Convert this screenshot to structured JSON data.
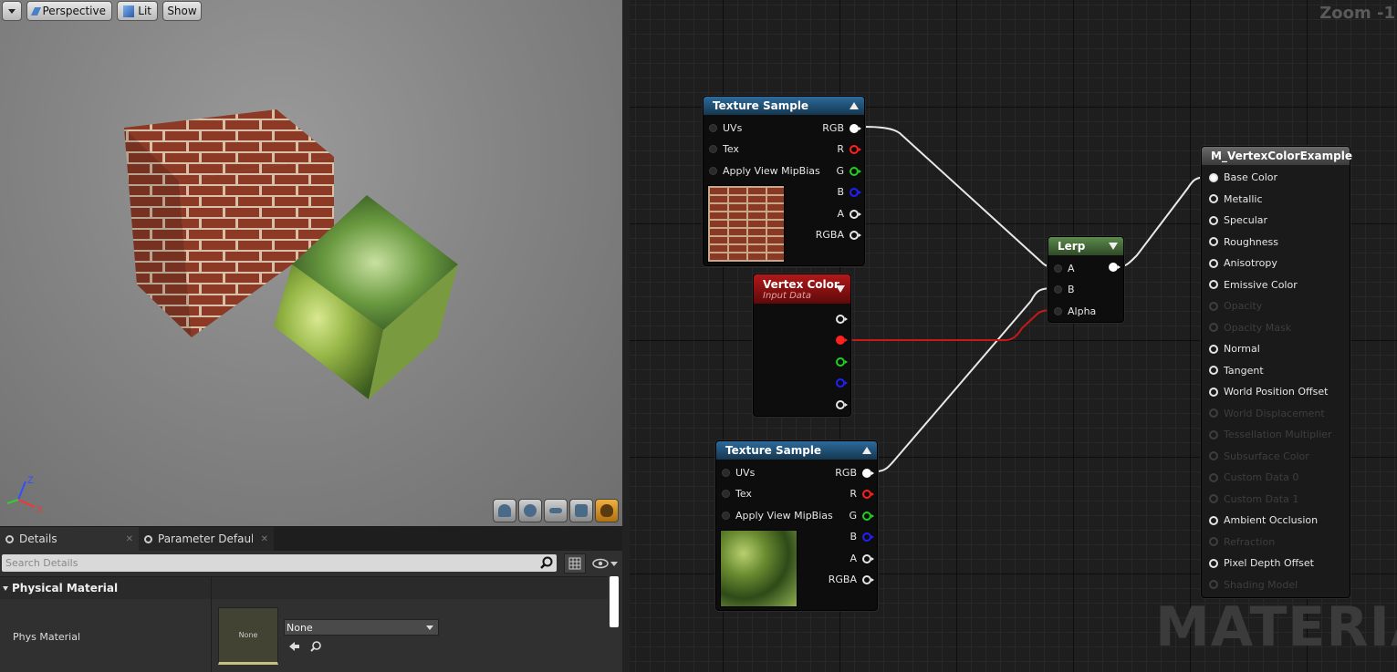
{
  "viewport": {
    "dropdown_icon": "chevron-down-icon",
    "perspective_label": "Perspective",
    "lit_label": "Lit",
    "show_label": "Show",
    "axis": {
      "z": "Z",
      "x": "X"
    }
  },
  "details": {
    "tabs": [
      {
        "label": "Details"
      },
      {
        "label": "Parameter Defaults"
      }
    ],
    "search_placeholder": "Search Details",
    "category": "Physical Material",
    "property_label": "Phys Material",
    "thumbnail_label": "None",
    "combo_value": "None"
  },
  "graph": {
    "zoom_label": "Zoom -1",
    "watermark": "MATERIAL",
    "texture_sample_1": {
      "title": "Texture Sample",
      "inputs": [
        "UVs",
        "Tex",
        "Apply View MipBias"
      ],
      "outputs": [
        "RGB",
        "R",
        "G",
        "B",
        "A",
        "RGBA"
      ]
    },
    "vertex_color": {
      "title": "Vertex Color",
      "subtitle": "Input Data"
    },
    "texture_sample_2": {
      "title": "Texture Sample",
      "inputs": [
        "UVs",
        "Tex",
        "Apply View MipBias"
      ],
      "outputs": [
        "RGB",
        "R",
        "G",
        "B",
        "A",
        "RGBA"
      ]
    },
    "lerp": {
      "title": "Lerp",
      "inputs": [
        "A",
        "B",
        "Alpha"
      ]
    },
    "material": {
      "title": "M_VertexColorExample",
      "pins": [
        {
          "label": "Base Color",
          "enabled": true
        },
        {
          "label": "Metallic",
          "enabled": true
        },
        {
          "label": "Specular",
          "enabled": true
        },
        {
          "label": "Roughness",
          "enabled": true
        },
        {
          "label": "Anisotropy",
          "enabled": true
        },
        {
          "label": "Emissive Color",
          "enabled": true
        },
        {
          "label": "Opacity",
          "enabled": false
        },
        {
          "label": "Opacity Mask",
          "enabled": false
        },
        {
          "label": "Normal",
          "enabled": true
        },
        {
          "label": "Tangent",
          "enabled": true
        },
        {
          "label": "World Position Offset",
          "enabled": true
        },
        {
          "label": "World Displacement",
          "enabled": false
        },
        {
          "label": "Tessellation Multiplier",
          "enabled": false
        },
        {
          "label": "Subsurface Color",
          "enabled": false
        },
        {
          "label": "Custom Data 0",
          "enabled": false
        },
        {
          "label": "Custom Data 1",
          "enabled": false
        },
        {
          "label": "Ambient Occlusion",
          "enabled": true
        },
        {
          "label": "Refraction",
          "enabled": false
        },
        {
          "label": "Pixel Depth Offset",
          "enabled": true
        },
        {
          "label": "Shading Model",
          "enabled": false
        }
      ]
    },
    "colors": {
      "wire": "#e8e8e8",
      "wire_red": "#c81818",
      "pin_red": "#ff2020",
      "pin_green": "#20d020",
      "pin_blue": "#2020ff"
    }
  }
}
